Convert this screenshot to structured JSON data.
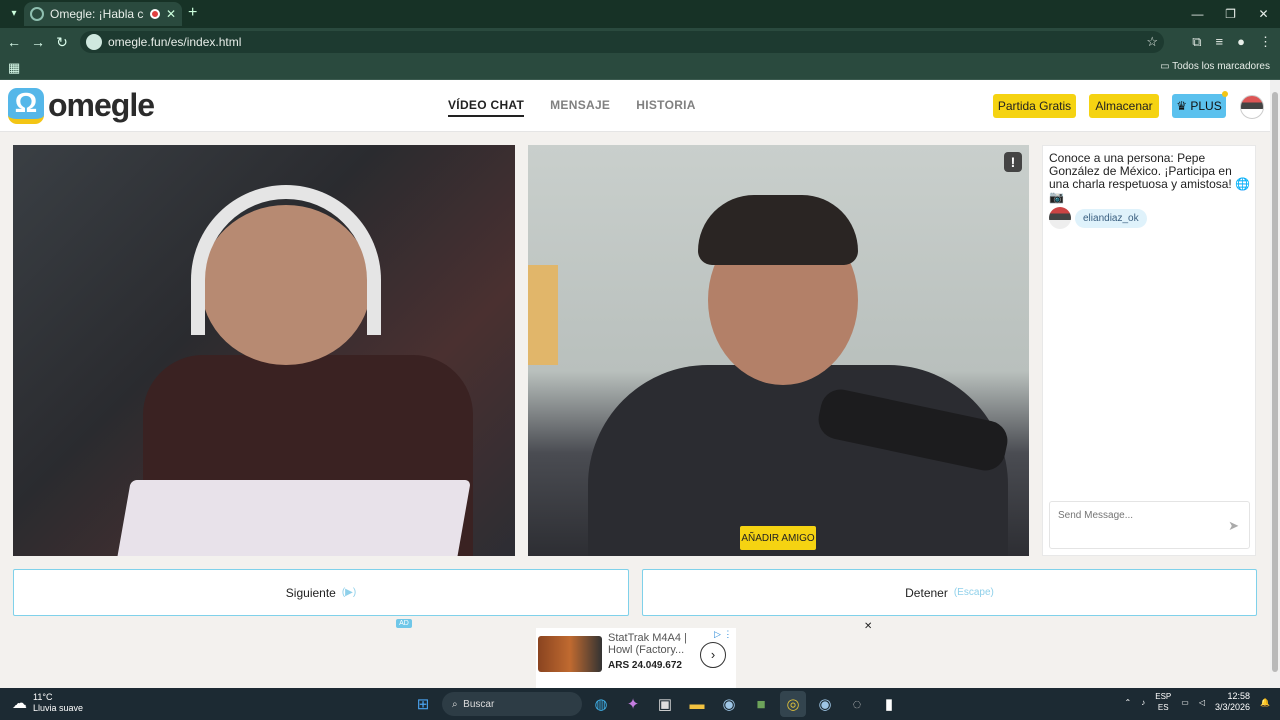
{
  "browser": {
    "tab_title": "Omegle: ¡Habla con Desco",
    "tab_close": "✕",
    "new_tab": "+",
    "url": "omegle.fun/es/index.html",
    "bookmarks_label": "Todos los marcadores",
    "window_controls": [
      "—",
      "❐",
      "✕"
    ]
  },
  "site": {
    "logo_mark": "Ω",
    "logo_text": "omegle",
    "nav": [
      "VÍDEO CHAT",
      "MENSAJE",
      "HISTORIA"
    ],
    "btn_partida": "Partida Gratis",
    "btn_almacenar": "Almacenar",
    "btn_plus": "♛ PLUS"
  },
  "video": {
    "report_icon": "!",
    "add_friend": "AÑADIR AMIGO"
  },
  "chat": {
    "intro": "Conoce a una persona: Pepe González de México. ¡Participa en una charla respetuosa y amistosa! 🌐 📷",
    "username": "eliandiaz_ok",
    "placeholder": "Send Message...",
    "send_icon": "➤"
  },
  "controls": {
    "next_label": "Siguiente",
    "next_hint": "(▶)",
    "stop_label": "Detener",
    "stop_hint": "(Escape)"
  },
  "ad": {
    "tag": "AD",
    "title": "StatTrak M4A4 | Howl (Factory...",
    "price": "ARS 24.049.672",
    "arrow": "›",
    "info": "▷ ⋮",
    "close": "✕"
  },
  "taskbar": {
    "temp": "11°C",
    "weather": "Lluvia suave",
    "search": "Buscar",
    "lang1": "ESP",
    "lang2": "ES",
    "time": "12:58",
    "date": "3/3/2026"
  },
  "colors": {
    "accent_yellow": "#f5d312",
    "accent_blue": "#5bc1ee",
    "browser_bg": "#2a4a3e"
  }
}
